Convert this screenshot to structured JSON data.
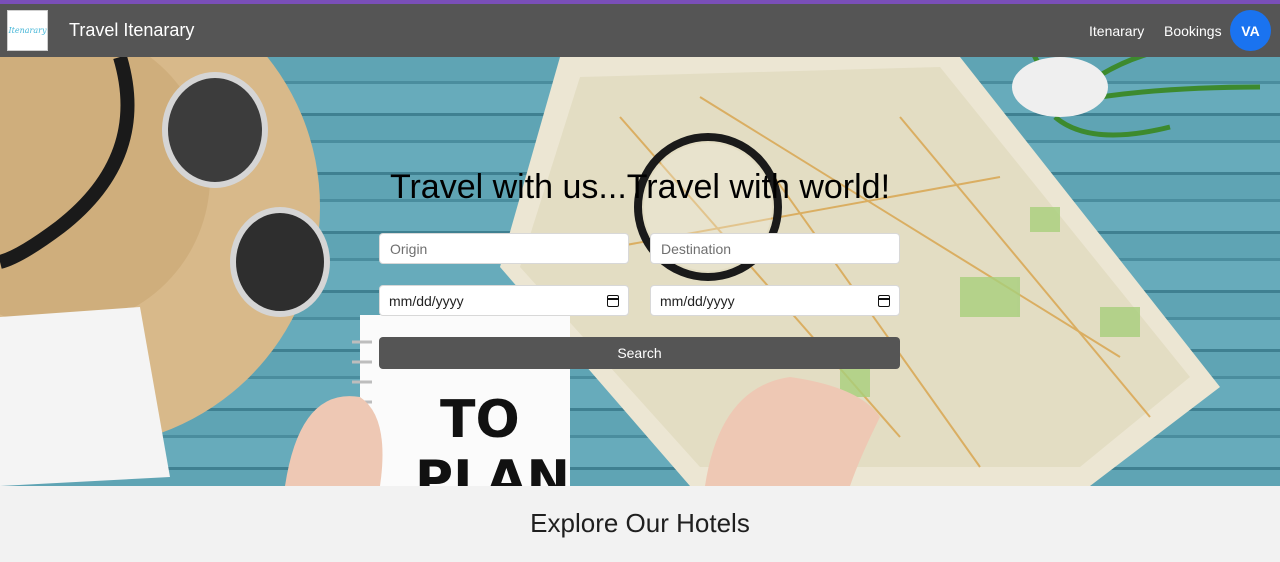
{
  "navbar": {
    "logo_text": "Itenarary",
    "brand": "Travel Itenarary",
    "links": [
      "Itenarary",
      "Bookings"
    ],
    "avatar_initials": "VA"
  },
  "hero": {
    "headline": "Travel with us...Travel with world!",
    "origin_placeholder": "Origin",
    "destination_placeholder": "Destination",
    "date_placeholder_1": "mm/dd/yyyy",
    "date_placeholder_2": "mm/dd/yyyy",
    "search_label": "Search",
    "notebook_text": "TO PLAN"
  },
  "explore": {
    "title": "Explore Our Hotels"
  },
  "colors": {
    "navbar": "#555555",
    "accent_line": "#7a4fb8",
    "avatar": "#1a73f0",
    "button": "#555555"
  }
}
